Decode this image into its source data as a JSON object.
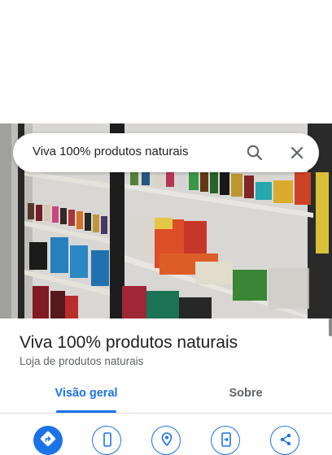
{
  "search": {
    "query": "Viva 100% produtos naturais"
  },
  "place": {
    "name": "Viva 100% produtos naturais",
    "category": "Loja de produtos naturais"
  },
  "tabs": [
    {
      "label": "Visão geral",
      "selected": true
    },
    {
      "label": "Sobre",
      "selected": false
    }
  ],
  "actions": [
    {
      "icon": "directions-icon"
    },
    {
      "icon": "phone-icon"
    },
    {
      "icon": "location-pin-icon"
    },
    {
      "icon": "send-to-phone-icon"
    },
    {
      "icon": "share-icon"
    }
  ],
  "colors": {
    "accent": "#1a73e8",
    "text_primary": "#202124",
    "text_secondary": "#5f6368"
  }
}
